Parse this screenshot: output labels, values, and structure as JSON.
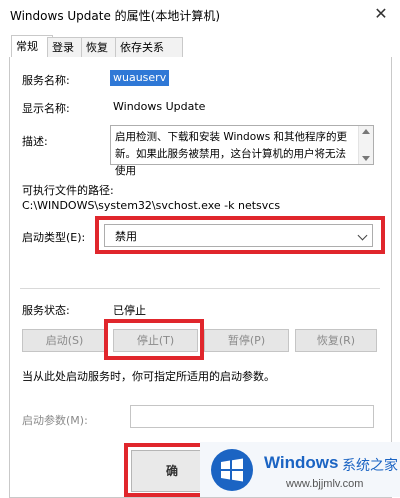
{
  "window": {
    "title": "Windows Update 的属性(本地计算机)",
    "close_label": "✕"
  },
  "tabs": [
    {
      "label": "常规",
      "active": true
    },
    {
      "label": "登录",
      "active": false
    },
    {
      "label": "恢复",
      "active": false
    },
    {
      "label": "依存关系",
      "active": false
    }
  ],
  "service": {
    "name_label": "服务名称:",
    "name_value": "wuauserv",
    "display_label": "显示名称:",
    "display_value": "Windows Update",
    "desc_label": "描述:",
    "desc_value": "启用检测、下载和安装 Windows 和其他程序的更新。如果此服务被禁用，这台计算机的用户将无法使用",
    "path_label": "可执行文件的路径:",
    "path_value": "C:\\WINDOWS\\system32\\svchost.exe -k netsvcs",
    "startup_label": "启动类型(E):",
    "startup_value": "禁用"
  },
  "status": {
    "label": "服务状态:",
    "value": "已停止"
  },
  "controls": {
    "start": "启动(S)",
    "stop": "停止(T)",
    "pause": "暂停(P)",
    "resume": "恢复(R)"
  },
  "hint": "当从此处启动服务时，你可指定所适用的启动参数。",
  "params": {
    "label": "启动参数(M):",
    "value": ""
  },
  "footer": {
    "ok_label": "确"
  },
  "watermark": {
    "brand": "Windows",
    "cn": "系统之家",
    "url": "www.bjjmlv.com"
  },
  "colors": {
    "highlight": "#e0262c",
    "selection": "#2f78d6",
    "brand": "#1b64c3"
  }
}
